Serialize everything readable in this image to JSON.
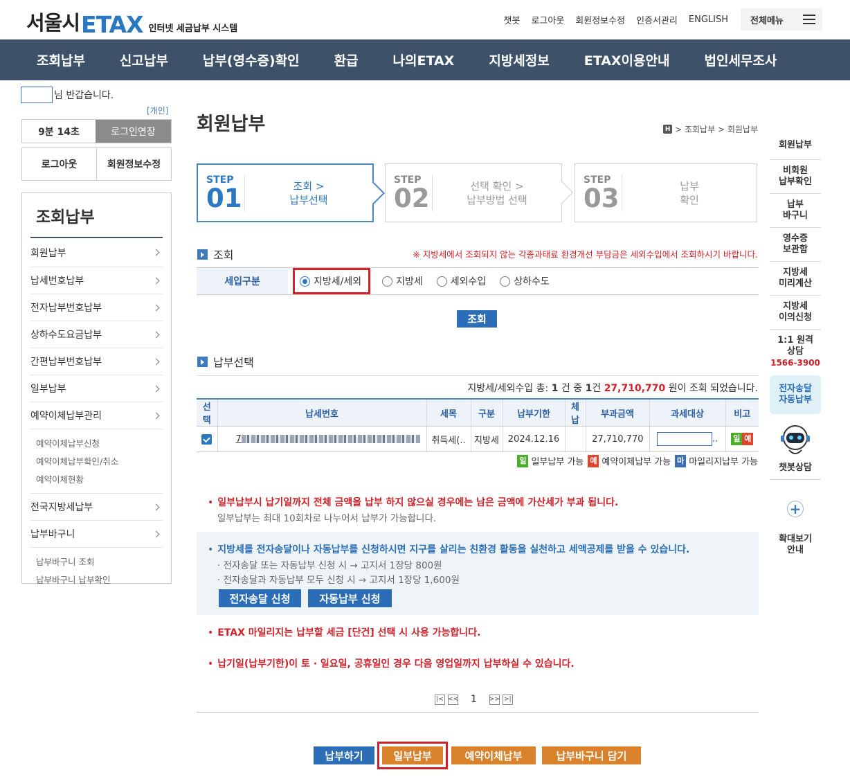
{
  "header": {
    "logo_korean": "서울시",
    "logo_etax": "ETAX",
    "logo_sub": "인터넷 세금납부 시스템",
    "utils": [
      "챗봇",
      "로그아웃",
      "회원정보수정",
      "인증서관리",
      "ENGLISH"
    ],
    "all_menu": "전체메뉴"
  },
  "gnb": [
    "조회납부",
    "신고납부",
    "납부(영수증)확인",
    "환급",
    "나의ETAX",
    "지방세정보",
    "ETAX이용안내",
    "법인세무조사"
  ],
  "sidebar": {
    "welcome_suffix": "님 반갑습니다.",
    "user_type": "[개인]",
    "timer": "9분 14초",
    "extend_login": "로그인연장",
    "logout": "로그아웃",
    "edit_member": "회원정보수정",
    "title": "조회납부",
    "items": [
      {
        "label": "회원납부"
      },
      {
        "label": "납세번호납부"
      },
      {
        "label": "전자납부번호납부"
      },
      {
        "label": "상하수도요금납부"
      },
      {
        "label": "간편납부번호납부"
      },
      {
        "label": "일부납부"
      },
      {
        "label": "예약이체납부관리"
      }
    ],
    "reserve_subs": [
      "예약이체납부신청",
      "예약이체납부확인/취소",
      "예약이체현황"
    ],
    "items2": [
      {
        "label": "전국지방세납부"
      },
      {
        "label": "납부바구니"
      }
    ],
    "basket_subs": [
      "납부바구니 조회",
      "납부바구니 납부확인"
    ]
  },
  "main": {
    "title": "회원납부",
    "breadcrumb": [
      "조회납부",
      "회원납부"
    ],
    "home_icon": "H",
    "steps": [
      {
        "label": "STEP",
        "num": "01",
        "line1": "조회 >",
        "line2": "납부선택"
      },
      {
        "label": "STEP",
        "num": "02",
        "line1": "선택 확인 >",
        "line2": "납부방법 선택"
      },
      {
        "label": "STEP",
        "num": "03",
        "line1": "납부",
        "line2": "확인"
      }
    ],
    "search_title": "조회",
    "search_notice": "※ 지방세에서 조회되지 않는 각종과태료 환경개선 부담금은 세외수입에서 조회하시기 바랍니다.",
    "filter_label": "세입구분",
    "radios": [
      "지방세/세외",
      "지방세",
      "세외수입",
      "상하수도"
    ],
    "search_button": "조회",
    "select_title": "납부선택",
    "result": {
      "prefix": "지방세/세외수입 총: ",
      "count1": "1",
      "mid1": " 건 중 ",
      "count2": "1",
      "mid2": "건 ",
      "amount": "27,710,770",
      "suffix": " 원이 조회 되었습니다."
    },
    "table": {
      "headers": [
        "선택",
        "납세번호",
        "세목",
        "구분",
        "납부기한",
        "체납",
        "부과금액",
        "과세대상",
        "비고"
      ],
      "row": {
        "tax_no_prefix": "7",
        "item": "취득세(..",
        "type": "지방세",
        "due": "2024.12.16",
        "arrears": "",
        "amount": "27,710,770",
        "target_suffix": "..",
        "tag1": "일",
        "tag2": "예"
      }
    },
    "legend": [
      {
        "tag": "일",
        "text": "일부납부 가능"
      },
      {
        "tag": "예",
        "text": "예약이체납부 가능"
      },
      {
        "tag": "마",
        "text": "마일리지납부 가능"
      }
    ],
    "notes": {
      "n1_red": "일부납부시 납기일까지 전체 금액을 납부 하지 않으실 경우에는 남은 금액에 가산세가 부과 됩니다.",
      "n1_sub": "일부납부는 최대 10회차로 나누어서 납부가 가능합니다.",
      "n2_blue": "지방세를 전자송달이나 자동납부를 신청하시면 지구를 살리는 친환경 활동을 실천하고 세액공제를 받을 수 있습니다.",
      "n2_sub1": "· 전자송달 또는 자동납부 신청 시 → 고지서 1장당 800원",
      "n2_sub2": "· 전자송달과 자동납부 모두 신청 시 → 고지서 1장당 1,600원",
      "btn_esend": "전자송달 신청",
      "btn_auto": "자동납부 신청",
      "n3_red": "ETAX 마일리지는 납부할 세금 [단건] 선택 시 사용 가능합니다.",
      "n4_red": "납기일(납부기한)이 토 · 일요일, 공휴일인 경우 다음 영업일까지 납부하실 수 있습니다."
    },
    "pager": {
      "current": "1"
    },
    "actions": [
      "납부하기",
      "일부납부",
      "예약이체납부",
      "납부바구니 담기"
    ]
  },
  "quick": {
    "items": [
      "회원납부",
      "비회원\n납부확인",
      "납부\n바구니",
      "영수증\n보관함",
      "지방세\n미리계산",
      "지방세\n이의신청"
    ],
    "consult": "1:1 원격\n상담",
    "phone": "1566-3900",
    "auto": "전자송달\n자동납부",
    "chatbot": "챗봇상담",
    "zoom": "확대보기\n안내"
  },
  "colors": {
    "gnb_bg": "#3d5268",
    "brand_blue": "#2b78c2",
    "highlight_red": "#d0202a",
    "button_blue": "#2b6db6",
    "button_orange": "#d9822b"
  }
}
